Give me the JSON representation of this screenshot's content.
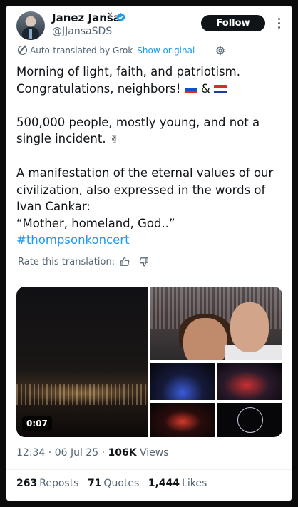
{
  "author": {
    "name": "Janez Janša",
    "handle": "@JJansaSDS",
    "follow_label": "Follow"
  },
  "translation": {
    "notice": "Auto-translated by Grok",
    "show_original": "Show original",
    "rate_label": "Rate this translation:"
  },
  "post": {
    "line1": "Morning of light, faith, and patriotism.",
    "line2_text": "Congratulations, neighbors!",
    "line2_amp": "&",
    "para2": "500,000 people, mostly young, and not a single incident.",
    "victory": "✌",
    "para3": "A manifestation of the eternal values of our civilization, also expressed in the words of Ivan Cankar:",
    "quote": "“Mother, homeland, God..”",
    "hashtag": "#thompsonkoncert"
  },
  "media": {
    "video_duration": "0:07"
  },
  "meta": {
    "time": "12:34 · 06 Jul 25 ·",
    "views_count": "106K",
    "views_label": "Views"
  },
  "stats": {
    "reposts_count": "263",
    "reposts_label": "Reposts",
    "quotes_count": "71",
    "quotes_label": "Quotes",
    "likes_count": "1,444",
    "likes_label": "Likes"
  },
  "colors": {
    "accent": "#1d9bf0",
    "text": "#0f1419",
    "muted": "#536471"
  }
}
